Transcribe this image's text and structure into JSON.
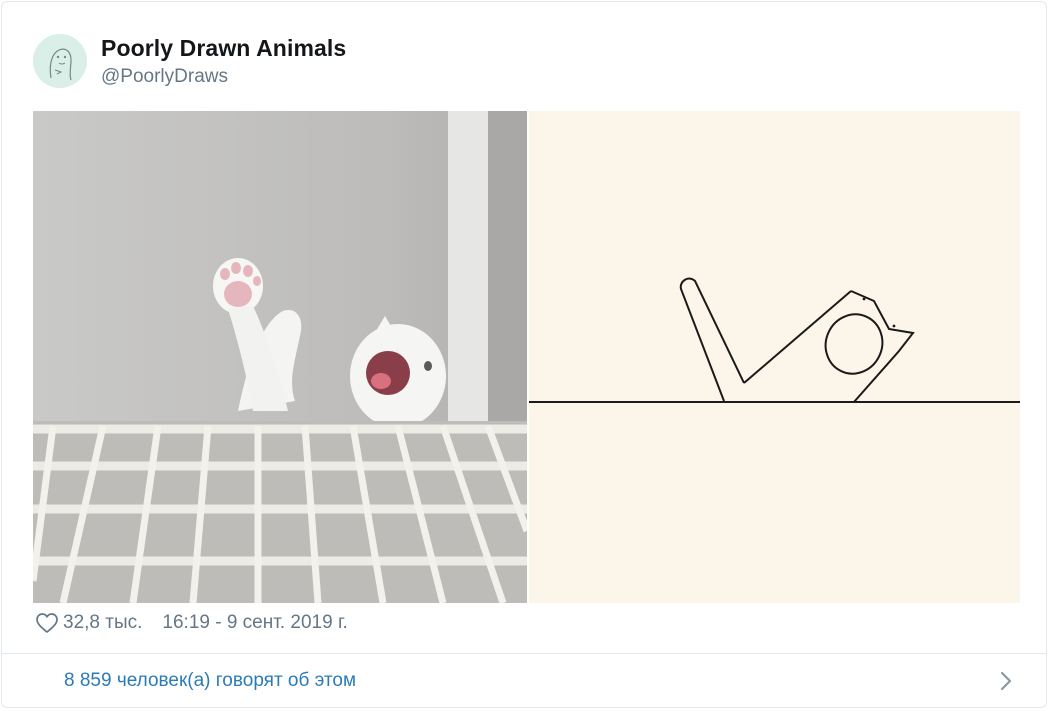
{
  "author": {
    "display_name": "Poorly Drawn Animals",
    "handle": "@PoorlyDraws"
  },
  "media": {
    "images": [
      {
        "name": "cat-yawning-photo"
      },
      {
        "name": "poorly-drawn-cat-sketch"
      }
    ]
  },
  "meta": {
    "likes": "32,8 тыс.",
    "timestamp": "16:19 - 9 сент. 2019 г."
  },
  "discussion": {
    "label": "8 859 человек(а) говорят об этом"
  },
  "icons": {
    "like": "heart-icon",
    "more": "chevron-right-icon"
  },
  "colors": {
    "link": "#2b7bb9",
    "secondary_text": "#657786",
    "border": "#e1e8ed",
    "primary_text": "#14171a"
  }
}
